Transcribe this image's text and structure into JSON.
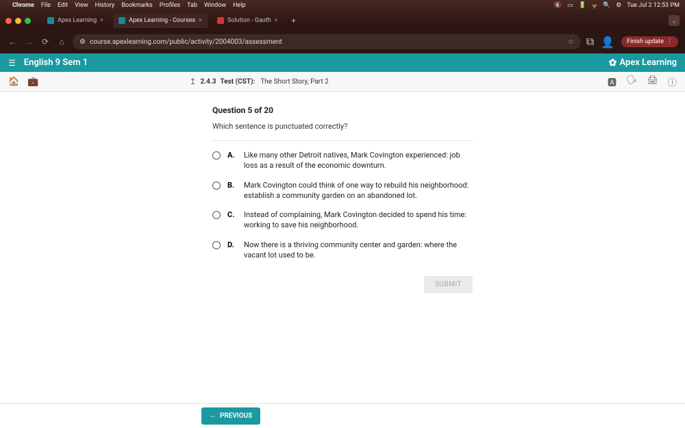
{
  "mac": {
    "app": "Chrome",
    "menus": [
      "File",
      "Edit",
      "View",
      "History",
      "Bookmarks",
      "Profiles",
      "Tab",
      "Window",
      "Help"
    ],
    "clock": "Tue Jul 2  12:53 PM"
  },
  "tabs": [
    {
      "title": "Apex Learning",
      "active": false
    },
    {
      "title": "Apex Learning - Courses",
      "active": true
    },
    {
      "title": "Solution - Gauth",
      "active": false
    }
  ],
  "url": "course.apexlearning.com/public/activity/2004003/assessment",
  "finish_update": "Finish update",
  "apex": {
    "course": "English 9 Sem 1",
    "brand": "Apex Learning"
  },
  "breadcrumb": {
    "code": "2.4.3",
    "type": "Test (CST):",
    "title": "The Short Story, Part 2"
  },
  "question": {
    "header": "Question 5 of 20",
    "prompt": "Which sentence is punctuated correctly?",
    "choices": [
      {
        "letter": "A.",
        "text": "Like many other Detroit natives, Mark Covington experienced: job loss as a result of the economic downturn."
      },
      {
        "letter": "B.",
        "text": "Mark Covington could think of one way to rebuild his neighborhood: establish a community garden on an abandoned lot."
      },
      {
        "letter": "C.",
        "text": "Instead of complaining, Mark Covington decided to spend his time: working to save his neighborhood."
      },
      {
        "letter": "D.",
        "text": "Now there is a thriving community center and garden: where the vacant lot used to be."
      }
    ],
    "submit": "SUBMIT"
  },
  "footer": {
    "previous": "PREVIOUS"
  }
}
